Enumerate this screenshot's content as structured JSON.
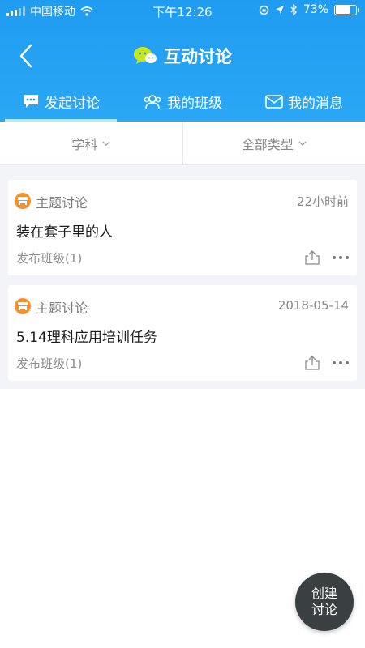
{
  "status_bar": {
    "carrier": "中国移动",
    "time": "下午12:26",
    "battery": "73%",
    "battery_level": 0.73
  },
  "nav": {
    "title": "互动讨论",
    "icons": {
      "back": "chevron-left-icon",
      "title": "chat-bubbles-icon"
    }
  },
  "tabs": [
    {
      "label": "发起讨论",
      "icon": "message-icon",
      "active": true
    },
    {
      "label": "我的班级",
      "icon": "group-icon",
      "active": false
    },
    {
      "label": "我的消息",
      "icon": "envelope-icon",
      "active": false
    }
  ],
  "filters": [
    {
      "label": "学科"
    },
    {
      "label": "全部类型"
    }
  ],
  "cards": [
    {
      "type": "主题讨论",
      "time": "22小时前",
      "topic": "装在套子里的人",
      "classes": "发布班级(1)"
    },
    {
      "type": "主题讨论",
      "time": "2018-05-14",
      "topic": "5.14理科应用培训任务",
      "classes": "发布班级(1)"
    }
  ],
  "fab": {
    "line1": "创建",
    "line2": "讨论"
  },
  "colors": {
    "header_blue": "#1f9cf0",
    "badge_orange": "#f5902b",
    "title_icon_green": "#c8e61c",
    "fab_dark": "#3a4041"
  }
}
